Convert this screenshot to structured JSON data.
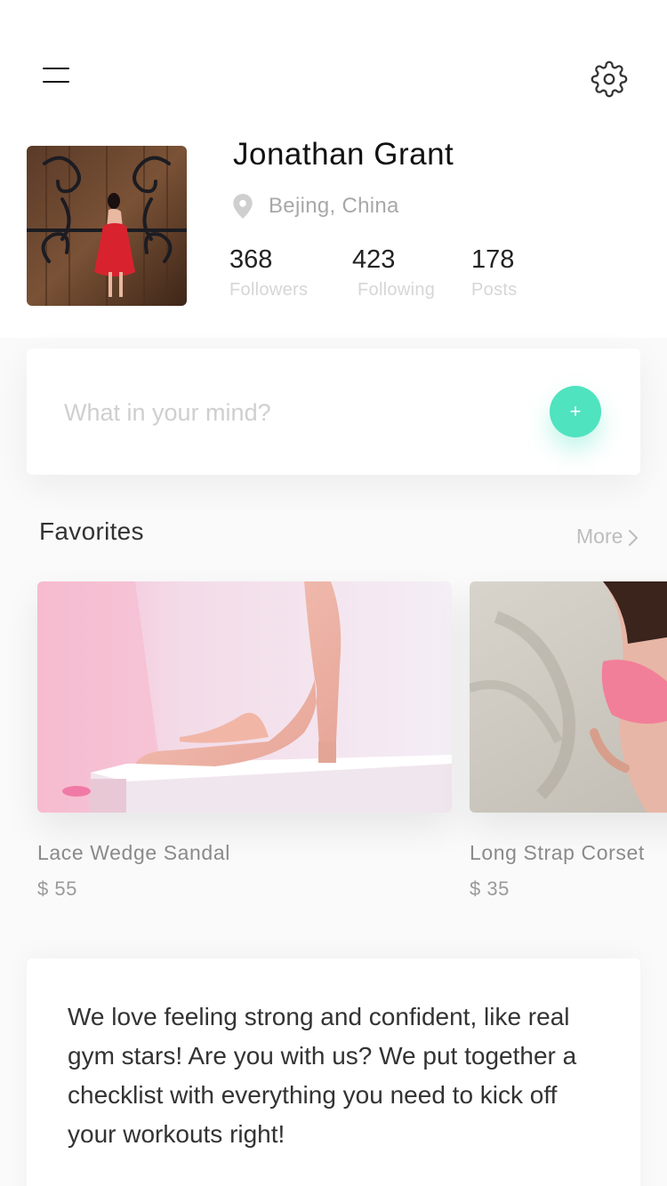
{
  "profile": {
    "name": "Jonathan Grant",
    "location": "Bejing, China",
    "stats": [
      {
        "value": "368",
        "label": "Followers"
      },
      {
        "value": "423",
        "label": "Following"
      },
      {
        "value": "178",
        "label": "Posts"
      }
    ]
  },
  "compose": {
    "placeholder": "What in your mind?",
    "add_label": "+"
  },
  "favorites": {
    "title": "Favorites",
    "more_label": "More",
    "items": [
      {
        "name": "Lace Wedge Sandal",
        "price": "$ 55"
      },
      {
        "name": "Long Strap Corset",
        "price": "$ 35"
      }
    ]
  },
  "post": {
    "text": "We love feeling strong and confident, like real gym stars! Are you with us? We put together a checklist with everything you need to kick off your workouts right!"
  },
  "colors": {
    "accent": "#4fe3bf",
    "muted_text": "#a8a8a8"
  },
  "icons": [
    "menu-icon",
    "gear-icon",
    "location-pin-icon",
    "plus-icon",
    "chevron-right-icon"
  ]
}
